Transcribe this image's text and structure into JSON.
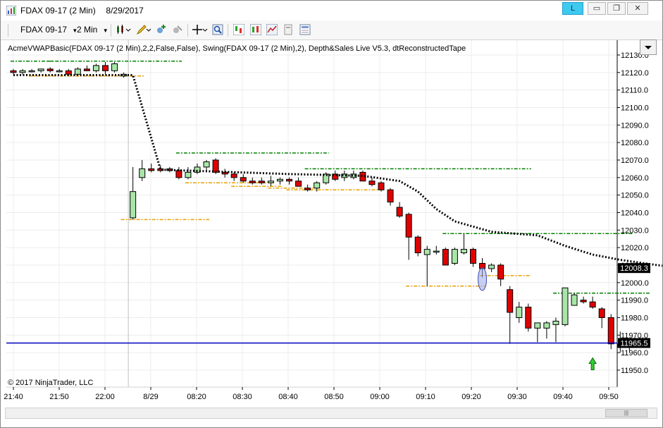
{
  "window": {
    "title": "FDAX 09-17 (2 Min)",
    "title_date": "8/29/2017",
    "linked_label": "L",
    "min_glyph": "▭",
    "max_glyph": "❐",
    "close_glyph": "✕"
  },
  "toolbar": {
    "instrument": "FDAX 09-17",
    "interval": "2 Min"
  },
  "chart": {
    "indicator_label": "AcmeVWAPBasic(FDAX 09-17 (2 Min),2,2,False,False), Swing(FDAX 09-17 (2 Min),2), Depth&Sales Live V5.3, dtReconstructedTape",
    "copyright": "© 2017 NinjaTrader, LLC",
    "last_price_label": "11965.5",
    "vwap_price_label": "12008.3",
    "colors": {
      "up": "#a8e6a8",
      "down": "#e00000",
      "vwap": "#000000",
      "swing_high": "#008000",
      "swing_low": "#e6a000",
      "price_line": "#0000c0"
    }
  },
  "chart_data": {
    "type": "candlestick",
    "y_ticks": [
      "12130.0",
      "12120.0",
      "12110.0",
      "12100.0",
      "12090.0",
      "12080.0",
      "12070.0",
      "12060.0",
      "12050.0",
      "12040.0",
      "12030.0",
      "12020.0",
      "12010.0",
      "12000.0",
      "11990.0",
      "11980.0",
      "11970.0",
      "11960.0",
      "11950.0"
    ],
    "x_ticks": [
      "21:40",
      "21:50",
      "22:00",
      "8/29",
      "08:20",
      "08:30",
      "08:40",
      "08:50",
      "09:00",
      "09:10",
      "09:20",
      "09:30",
      "09:40",
      "09:50"
    ],
    "ylim": [
      11944,
      12135
    ],
    "candles": [
      [
        12121,
        12122,
        12119,
        12120
      ],
      [
        12120,
        12122,
        12119,
        12121
      ],
      [
        12121,
        12122,
        12120,
        12121
      ],
      [
        12121,
        12122,
        12120,
        12122
      ],
      [
        12122,
        12123,
        12120,
        12121
      ],
      [
        12121,
        12122,
        12120,
        12121
      ],
      [
        12121,
        12122,
        12118,
        12119
      ],
      [
        12119,
        12123,
        12118,
        12122
      ],
      [
        12122,
        12124,
        12121,
        12121
      ],
      [
        12121,
        12125,
        12120,
        12124
      ],
      [
        12124,
        12126,
        12119,
        12121
      ],
      [
        12121,
        12126,
        12120,
        12125
      ],
      [
        12118,
        12120,
        12117,
        12119
      ],
      [
        12037,
        12066,
        12036,
        12052
      ],
      [
        12060,
        12070,
        12058,
        12065
      ],
      [
        12065,
        12068,
        12063,
        12064
      ],
      [
        12065,
        12067,
        12063,
        12064
      ],
      [
        12065,
        12066,
        12063,
        12064
      ],
      [
        12064,
        12066,
        12059,
        12060
      ],
      [
        12060,
        12066,
        12059,
        12063
      ],
      [
        12063,
        12068,
        12062,
        12066
      ],
      [
        12066,
        12070,
        12064,
        12069
      ],
      [
        12070,
        12071,
        12062,
        12063
      ],
      [
        12063,
        12065,
        12060,
        12062
      ],
      [
        12062,
        12063,
        12058,
        12060
      ],
      [
        12060,
        12062,
        12057,
        12058
      ],
      [
        12058,
        12060,
        12056,
        12057
      ],
      [
        12058,
        12060,
        12056,
        12057
      ],
      [
        12057,
        12061,
        12055,
        12058
      ],
      [
        12058,
        12060,
        12056,
        12059
      ],
      [
        12059,
        12060,
        12056,
        12058
      ],
      [
        12058,
        12060,
        12055,
        12055
      ],
      [
        12054,
        12056,
        12052,
        12053
      ],
      [
        12054,
        12058,
        12052,
        12057
      ],
      [
        12057,
        12063,
        12056,
        12062
      ],
      [
        12062,
        12064,
        12058,
        12059
      ],
      [
        12060,
        12064,
        12058,
        12062
      ],
      [
        12060,
        12064,
        12059,
        12062
      ],
      [
        12063,
        12064,
        12058,
        12058
      ],
      [
        12058,
        12060,
        12055,
        12056
      ],
      [
        12057,
        12058,
        12052,
        12053
      ],
      [
        12053,
        12054,
        12044,
        12046
      ],
      [
        12043,
        12046,
        12037,
        12038
      ],
      [
        12039,
        12040,
        12013,
        12026
      ],
      [
        12026,
        12027,
        12015,
        12017
      ],
      [
        12016,
        12021,
        11998,
        12019
      ],
      [
        12018,
        12021,
        12016,
        12018
      ],
      [
        12019,
        12020,
        12010,
        12010
      ],
      [
        12011,
        12020,
        12010,
        12019
      ],
      [
        12017,
        12028,
        12016,
        12019
      ],
      [
        12019,
        12020,
        12009,
        12011
      ],
      [
        12011,
        12014,
        12003,
        12008
      ],
      [
        12008,
        12011,
        12006,
        12010
      ],
      [
        12010,
        12011,
        11998,
        12002
      ],
      [
        11996,
        11998,
        11965,
        11983
      ],
      [
        11980,
        11989,
        11977,
        11986
      ],
      [
        11986,
        11988,
        11972,
        11974
      ],
      [
        11974,
        11977,
        11966,
        11977
      ],
      [
        11974,
        11978,
        11968,
        11977
      ],
      [
        11976,
        11980,
        11966,
        11978
      ],
      [
        11976,
        11997,
        11975,
        11997
      ],
      [
        11987,
        11994,
        11987,
        11993
      ],
      [
        11990,
        11992,
        11988,
        11989
      ],
      [
        11989,
        11992,
        11985,
        11986
      ],
      [
        11985,
        11986,
        11974,
        11980
      ],
      [
        11980,
        11982,
        11962,
        11965
      ],
      [
        11965,
        11972,
        11960,
        11963
      ],
      [
        11963,
        11966,
        11961,
        11965
      ]
    ],
    "vwap": [
      [
        0,
        12118.5
      ],
      [
        1,
        12118.5
      ],
      [
        13,
        12118.5
      ],
      [
        16,
        12064.5
      ],
      [
        30,
        12062
      ],
      [
        38,
        12061
      ],
      [
        42,
        12058
      ],
      [
        44,
        12052
      ],
      [
        46,
        12042
      ],
      [
        48,
        12035
      ],
      [
        52,
        12029
      ],
      [
        57,
        12027
      ],
      [
        60,
        12021
      ],
      [
        63,
        12016
      ],
      [
        66,
        12013
      ],
      [
        70,
        12010
      ],
      [
        73,
        12008.3
      ]
    ],
    "swing_high": [
      [
        0,
        12126.5,
        4
      ],
      [
        4,
        12126.5,
        14
      ],
      [
        18,
        12074,
        16
      ],
      [
        32,
        12065,
        24
      ],
      [
        47,
        12028,
        20
      ],
      [
        59,
        11994,
        10
      ]
    ],
    "swing_low": [
      [
        2,
        12118,
        12
      ],
      [
        12,
        12036,
        9
      ],
      [
        19,
        12057,
        9
      ],
      [
        24,
        12055,
        5
      ],
      [
        28,
        12054,
        5
      ],
      [
        30,
        12053,
        10
      ],
      [
        43,
        11998,
        8
      ],
      [
        51,
        12004,
        5
      ]
    ],
    "last_price": 11965.5,
    "vwap_last": 12008.3
  }
}
